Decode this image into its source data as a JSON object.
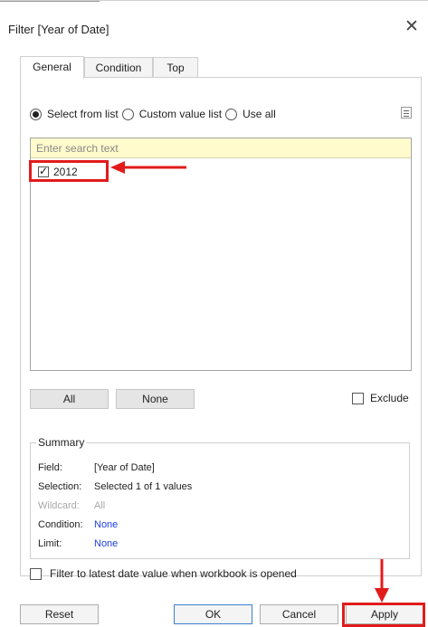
{
  "dialog": {
    "title": "Filter [Year of Date]",
    "close_symbol": "✕"
  },
  "tabs": [
    {
      "label": "General",
      "active": true
    },
    {
      "label": "Condition",
      "active": false
    },
    {
      "label": "Top",
      "active": false
    }
  ],
  "mode": {
    "options": [
      "Select from list",
      "Custom value list",
      "Use all"
    ],
    "selected": "Select from list"
  },
  "list": {
    "search_placeholder": "Enter search text",
    "items": [
      {
        "label": "2012",
        "checked": true
      }
    ]
  },
  "buttons": {
    "all": "All",
    "none": "None",
    "exclude": "Exclude"
  },
  "summary": {
    "title": "Summary",
    "field_label": "Field:",
    "field_value": "[Year of Date]",
    "selection_label": "Selection:",
    "selection_value": "Selected 1 of 1 values",
    "wildcard_label": "Wildcard:",
    "wildcard_value": "All",
    "condition_label": "Condition:",
    "condition_value": "None",
    "limit_label": "Limit:",
    "limit_value": "None"
  },
  "latest_date_option": "Filter to latest date value when workbook is opened",
  "footer": {
    "reset": "Reset",
    "ok": "OK",
    "cancel": "Cancel",
    "apply": "Apply"
  },
  "colors": {
    "highlight": "#e21b1b",
    "link_blue": "#1c3fe0",
    "search_bg": "#fffbcc"
  },
  "icons": {
    "menu": "list-menu-icon",
    "close": "close-icon",
    "checkmark": "checkmark-icon"
  }
}
